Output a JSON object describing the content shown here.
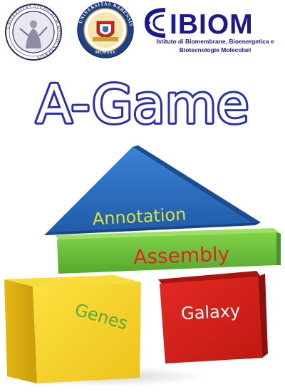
{
  "header": {
    "logo1": {
      "name": "university-milano-seal",
      "seal_text": "UNIVERSITAS STUDIORUM MEDIOLANENSIS"
    },
    "logo2": {
      "name": "university-bari-seal",
      "seal_text": "UNIVERSITAS BARENSIS",
      "year_text": "MCMXXV"
    },
    "ibiom": {
      "wordmark": "IBIOM",
      "line1": "Istituto di Biomembrane,  Bioenergetica e",
      "line2": "Biotecnologie Molecolari",
      "color": "#1a1a8c"
    }
  },
  "title": {
    "text": "A-Game",
    "color": "#2a2fb0"
  },
  "blocks": {
    "roof": {
      "label": "Annotation",
      "color": "#2a6fc0",
      "text_color": "#d8e23a"
    },
    "bar": {
      "label": "Assembly",
      "color": "#6cbf3c",
      "text_color": "#e0261e"
    },
    "left": {
      "label": "Genes",
      "color": "#f2d22a",
      "text_color": "#5aa83a"
    },
    "right": {
      "label": "Galaxy",
      "color": "#d8231d",
      "text_color": "#ffffff"
    }
  }
}
